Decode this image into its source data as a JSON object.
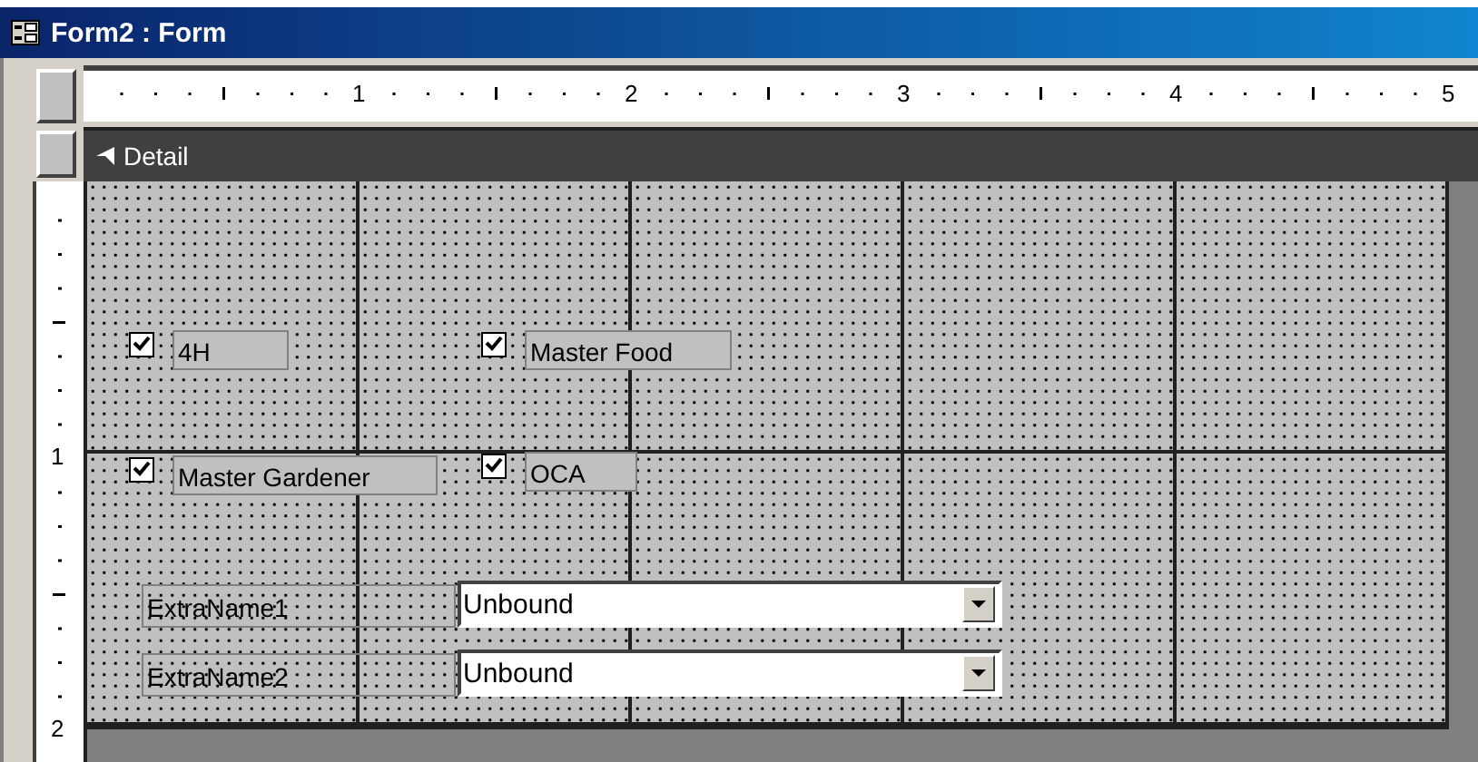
{
  "window": {
    "title": "Form2 : Form"
  },
  "ruler": {
    "horizontal_labels": [
      "1",
      "2",
      "3",
      "4",
      "5"
    ],
    "vertical_labels": [
      "1",
      "2"
    ]
  },
  "section": {
    "title": "Detail"
  },
  "checkboxes": [
    {
      "label": "4H",
      "checked": true
    },
    {
      "label": "Master Food",
      "checked": true
    },
    {
      "label": "Master Gardener",
      "checked": true
    },
    {
      "label": "OCA",
      "checked": true
    }
  ],
  "combos": [
    {
      "label": "ExtraName1",
      "value": "Unbound"
    },
    {
      "label": "ExtraName2",
      "value": "Unbound"
    }
  ]
}
